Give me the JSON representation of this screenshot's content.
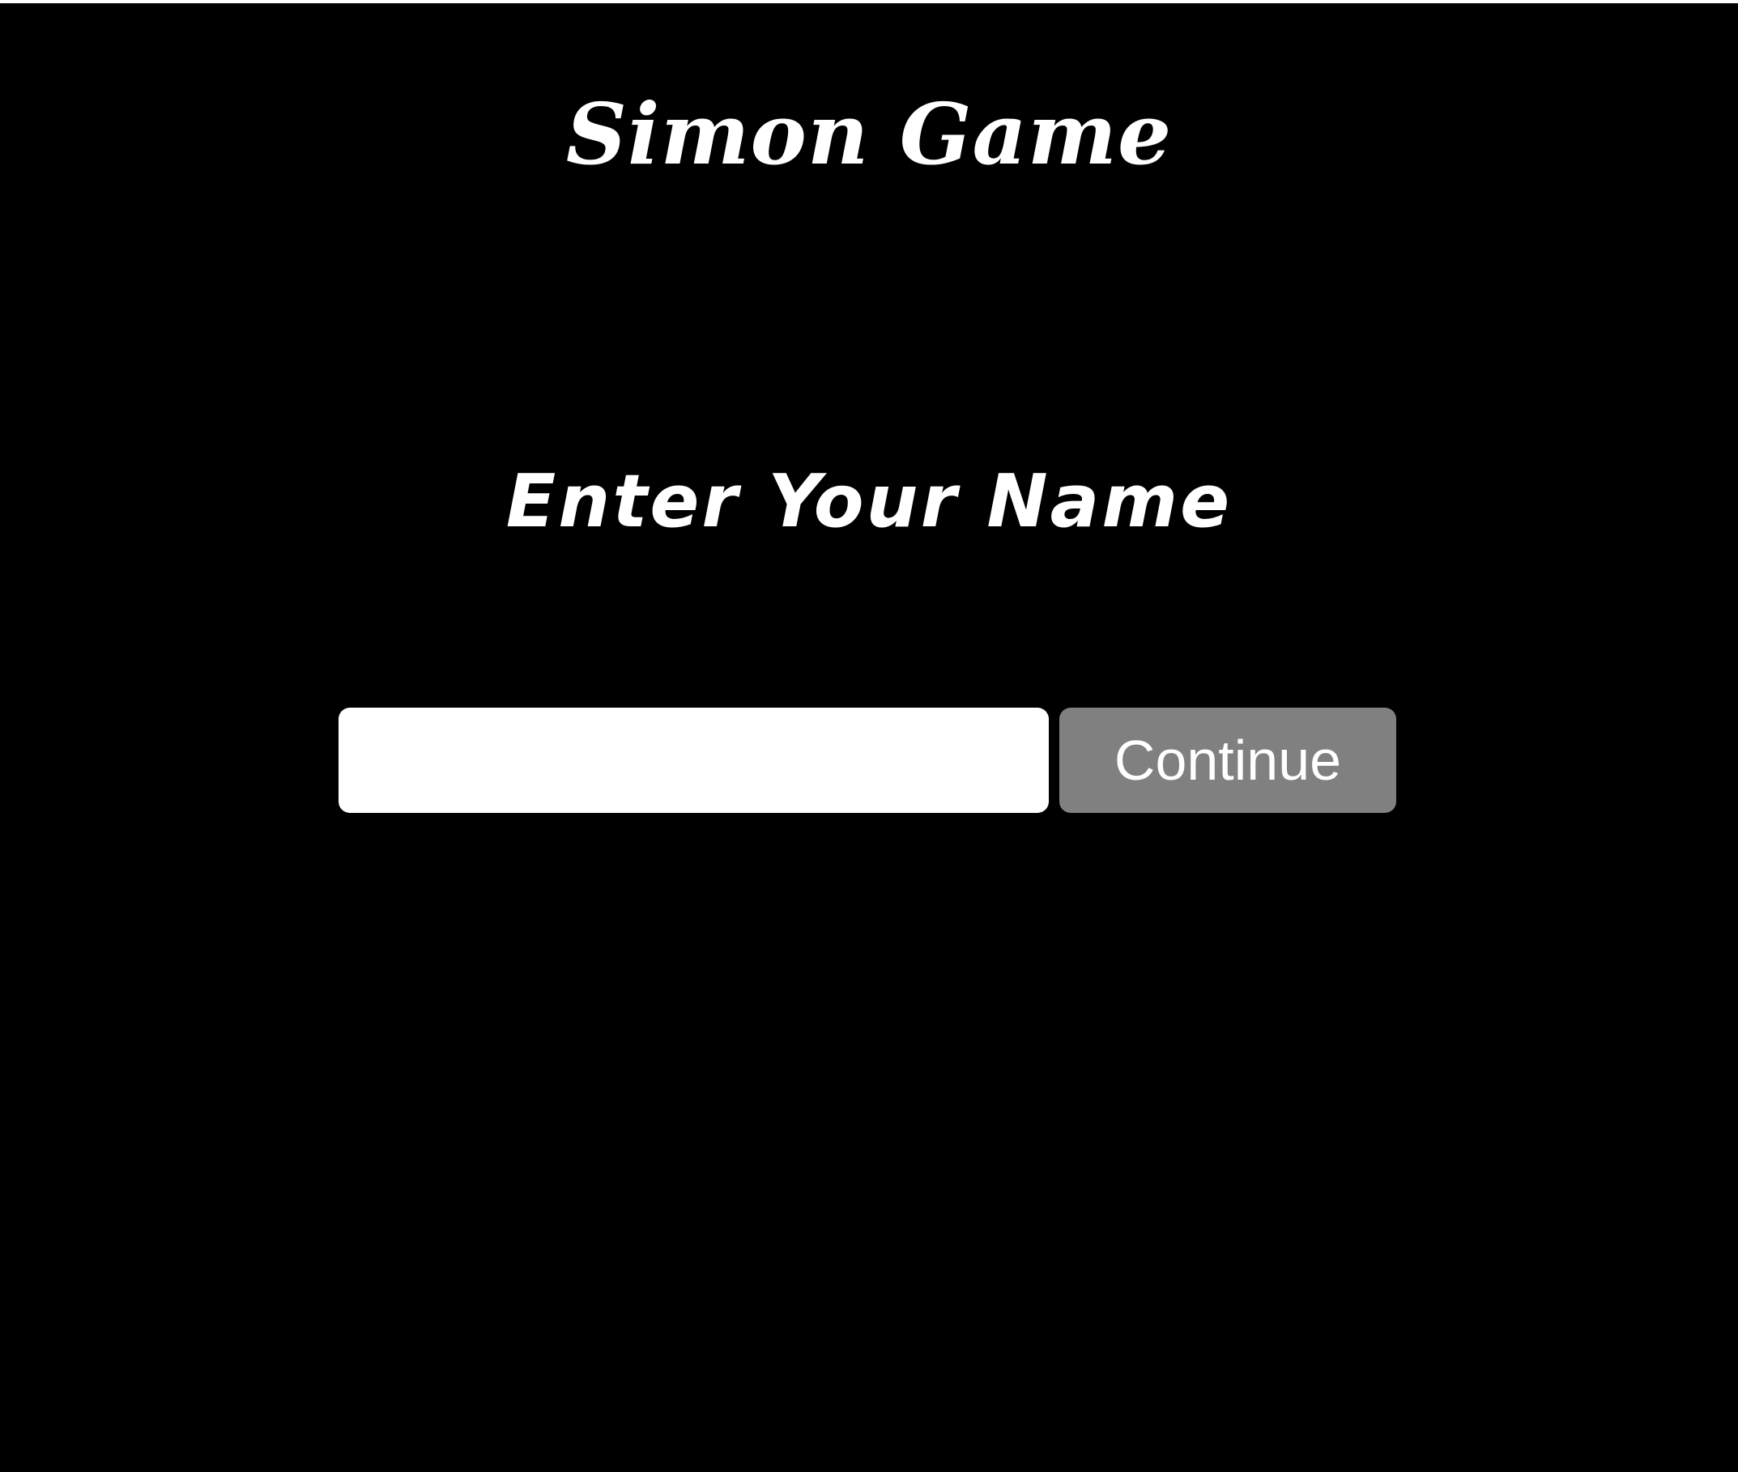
{
  "header": {
    "title": "Simon Game"
  },
  "main": {
    "prompt": "Enter Your Name",
    "name_input": {
      "value": "",
      "placeholder": ""
    },
    "continue_label": "Continue"
  },
  "colors": {
    "background": "#000000",
    "text": "#ffffff",
    "input_background": "#ffffff",
    "button_background": "#808080"
  }
}
